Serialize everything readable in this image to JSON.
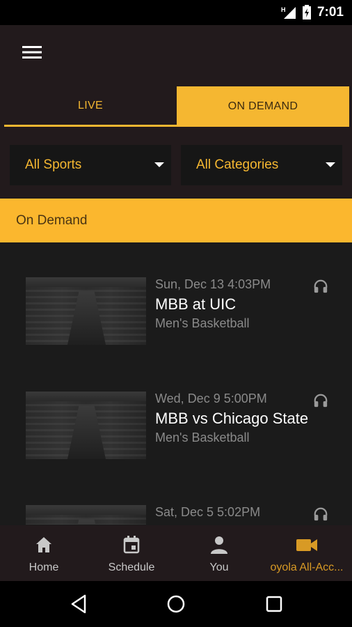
{
  "status_bar": {
    "time": "7:01",
    "network": "H"
  },
  "tabs": [
    {
      "label": "LIVE",
      "selected": false
    },
    {
      "label": "ON DEMAND",
      "selected": true
    }
  ],
  "filters": {
    "sports": {
      "selected": "All Sports"
    },
    "categories": {
      "selected": "All Categories"
    }
  },
  "section_title": "On Demand",
  "items": [
    {
      "date": "Sun, Dec 13 4:03PM",
      "title": "MBB at UIC",
      "category": "Men's Basketball",
      "icon": "headphones-icon"
    },
    {
      "date": "Wed, Dec 9 5:00PM",
      "title": "MBB vs Chicago State",
      "category": "Men's Basketball",
      "icon": "headphones-icon"
    },
    {
      "date": "Sat, Dec 5 5:02PM",
      "title": "",
      "category": "",
      "icon": "headphones-icon"
    }
  ],
  "bottom_nav": [
    {
      "label": "Home",
      "icon": "home-icon",
      "active": false
    },
    {
      "label": "Schedule",
      "icon": "calendar-icon",
      "active": false
    },
    {
      "label": "You",
      "icon": "person-icon",
      "active": false
    },
    {
      "label": "oyola All-Acc...",
      "icon": "video-camera-icon",
      "active": true
    }
  ],
  "colors": {
    "accent": "#f5b731",
    "section_bar": "#fbb72e",
    "header_bg": "#221a1c",
    "list_bg": "#1b1b1b",
    "active_nav": "#d89a25"
  }
}
